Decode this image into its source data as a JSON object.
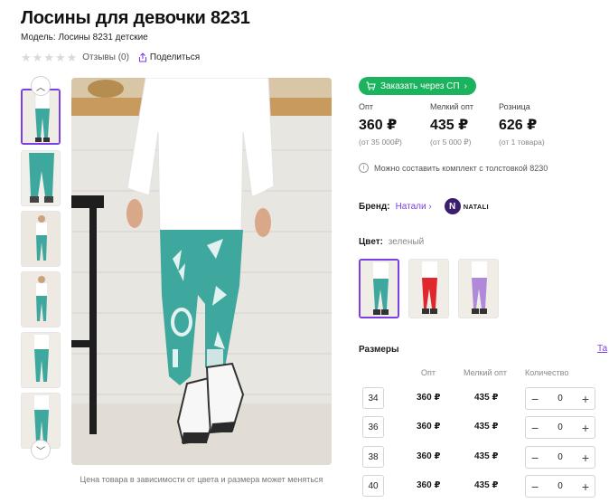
{
  "product": {
    "title": "Лосины для девочки 8231",
    "model": "Модель: Лосины 8231 детские",
    "reviews": "Отзывы (0)",
    "share": "Поделиться",
    "caption": "Цена товара в зависимости от цвета и размера может меняться"
  },
  "rating": {
    "value": 0,
    "max": 5
  },
  "order_button": "Заказать через СП",
  "prices": [
    {
      "label": "Опт",
      "value": "360 ₽",
      "note": "(от 35 000₽)"
    },
    {
      "label": "Мелкий опт",
      "value": "435 ₽",
      "note": "(от 5 000 ₽)"
    },
    {
      "label": "Розница",
      "value": "626 ₽",
      "note": "(от 1 товара)"
    }
  ],
  "info": "Можно составить комплект с толстовкой 8230",
  "brand": {
    "label": "Бренд:",
    "name": "Натали",
    "logo_text": "NATALI",
    "logo_letter": "N"
  },
  "color": {
    "label": "Цвет:",
    "value": "зеленый"
  },
  "sizes": {
    "title": "Размеры",
    "table_link": "Та",
    "headers": {
      "opt": "Опт",
      "small": "Мелкий опт",
      "qty": "Количество"
    },
    "rows": [
      {
        "size": "34",
        "opt": "360 ₽",
        "small": "435 ₽",
        "qty": "0"
      },
      {
        "size": "36",
        "opt": "360 ₽",
        "small": "435 ₽",
        "qty": "0"
      },
      {
        "size": "38",
        "opt": "360 ₽",
        "small": "435 ₽",
        "qty": "0"
      },
      {
        "size": "40",
        "opt": "360 ₽",
        "small": "435 ₽",
        "qty": "0"
      }
    ]
  },
  "colors": {
    "accent": "#7b3fe4",
    "green": "#1bb35d",
    "teal": "#3ea89e"
  }
}
